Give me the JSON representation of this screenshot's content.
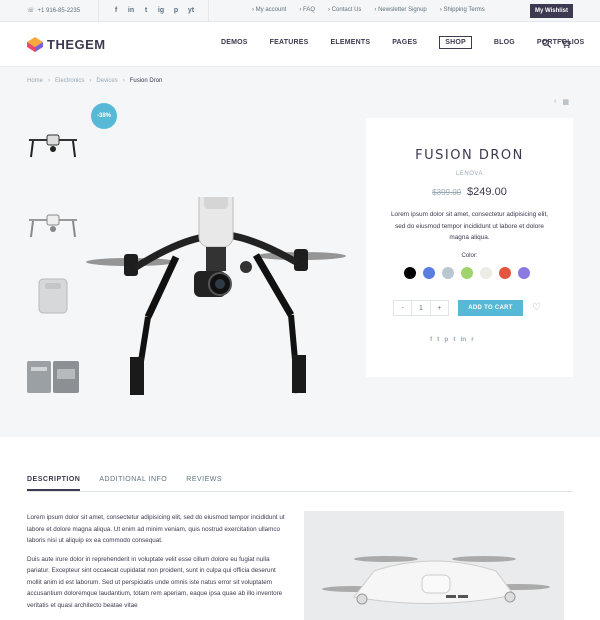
{
  "topbar": {
    "phone": "+1 916-85-2235",
    "socials": [
      "f",
      "in",
      "t",
      "ig",
      "p",
      "yt"
    ],
    "links": [
      "My account",
      "FAQ",
      "Contact Us",
      "Newsletter Signup",
      "Shipping Terms"
    ],
    "wishlist": "My Wishlist"
  },
  "header": {
    "logo_text": "THEGEM",
    "nav": [
      "DEMOS",
      "FEATURES",
      "ELEMENTS",
      "PAGES",
      "SHOP",
      "BLOG",
      "PORTFOLIOS"
    ],
    "active_nav": "SHOP"
  },
  "breadcrumb": [
    "Home",
    "Electronics",
    "Devices",
    "Fusion Dron"
  ],
  "product": {
    "sale_badge": "-38%",
    "title": "FUSION DRON",
    "brand": "LENOVA",
    "old_price": "$399.00",
    "new_price": "$249.00",
    "description": "Lorem ipsum dolor sit amet, consectetur adipisicing elit, sed do eiusmod tempor incididunt ut labore et dolore magna aliqua.",
    "color_label": "Color:",
    "colors": [
      "#000000",
      "#5a7de0",
      "#b9c7d2",
      "#9ed46b",
      "#ecebe6",
      "#e5543e",
      "#8b7be0"
    ],
    "quantity": "1",
    "minus": "-",
    "plus": "+",
    "add_to_cart": "ADD TO CART",
    "share_icons": [
      "f",
      "t",
      "p",
      "t",
      "in",
      "r"
    ]
  },
  "tabs": [
    "DESCRIPTION",
    "ADDITIONAL INFO",
    "REVIEWS"
  ],
  "description": {
    "p1": "Lorem ipsum dolor sit amet, consectetur adipisicing elit, sed do eiusmod tempor incididunt ut labore et dolore magna aliqua. Ut enim ad minim veniam, quis nostrud exercitation ullamco laboris nisi ut aliquip ex ea commodo consequat.",
    "p2": "Duis aute irure dolor in reprehenderit in voluptate velit esse cillum dolore eu fugiat nulla pariatur. Excepteur sint occaecat cupidatat non proident, sunt in culpa qui officia deserunt mollit anim id est laborum. Sed ut perspiciatis unde omnis iste natus error sit voluptatem accusantium doloremque laudantium, totam rem aperiam, eaque ipsa quae ab illo inventore veritatis et quasi architecto beatae vitae"
  }
}
